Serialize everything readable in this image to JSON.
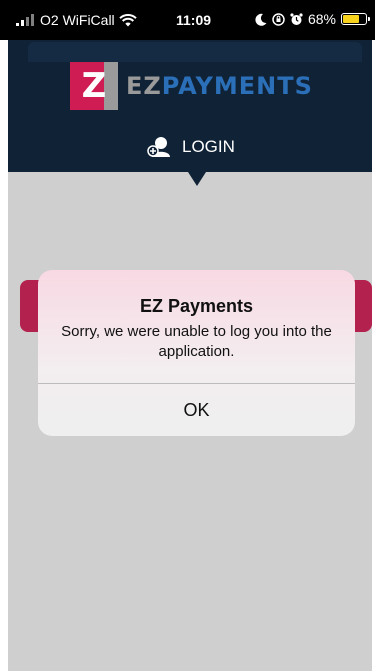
{
  "status_bar": {
    "carrier": "O2 WiFiCall",
    "time": "11:09",
    "battery": "68%"
  },
  "header": {
    "logo_mark": "Z",
    "logo_text_1": "EZ",
    "logo_text_2": "PAYMENTS",
    "login_label": "LOGIN"
  },
  "alert": {
    "title": "EZ Payments",
    "message": "Sorry, we were unable to log you into the application.",
    "ok_label": "OK"
  },
  "icons": {
    "wifi": "wifi-icon",
    "moon": "moon-icon",
    "lock_rotation": "orientation-lock-icon",
    "alarm": "alarm-icon",
    "battery": "battery-icon",
    "user": "user-add-icon"
  },
  "colors": {
    "header": "#0f2236",
    "brand": "#cf1c52",
    "payments": "#2b6fb8",
    "background": "#cfcfcf"
  }
}
